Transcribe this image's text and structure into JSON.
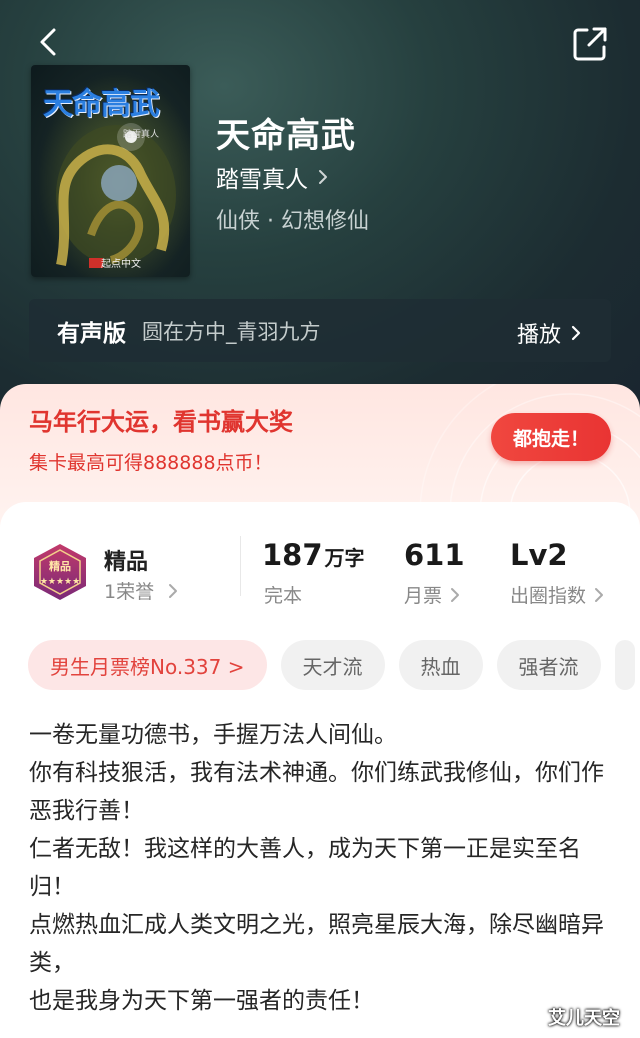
{
  "header": {
    "back_icon": "chevron-left-icon",
    "share_icon": "share-external-icon"
  },
  "book": {
    "cover_title": "天命高武",
    "cover_author": "踏雪真人",
    "cover_publisher": "起点中文",
    "title": "天命高武",
    "author": "踏雪真人",
    "genre": "仙侠 · 幻想修仙"
  },
  "audio": {
    "label": "有声版",
    "narrator": "圆在方中_青羽九方",
    "play_label": "播放"
  },
  "promo": {
    "title": "马年行大运，看书赢大奖",
    "subtitle": "集卡最高可得888888点币！",
    "button_label": "都抱走！"
  },
  "stats": {
    "quality_label": "精品",
    "honor": "1荣誉",
    "badge_text": "精品",
    "word_count": "187",
    "word_unit": "万字",
    "status": "完本",
    "monthly_votes": "611",
    "monthly_votes_label": "月票",
    "level": "Lv2",
    "level_label": "出圈指数"
  },
  "tags": [
    "男生月票榜No.337 >",
    "天才流",
    "热血",
    "强者流"
  ],
  "description": [
    "一卷无量功德书，手握万法人间仙。",
    "你有科技狠活，我有法术神通。你们练武我修仙，你们作恶我行善！",
    "仁者无敌！我这样的大善人，成为天下第一正是实至名归！",
    "点燃热血汇成人类文明之光，照亮星辰大海，除尽幽暗异类，",
    "也是我身为天下第一强者的责任！"
  ],
  "watermark": "艾儿天空",
  "colors": {
    "accent_red": "#e0352f",
    "hero_bg": "#1f3235"
  }
}
